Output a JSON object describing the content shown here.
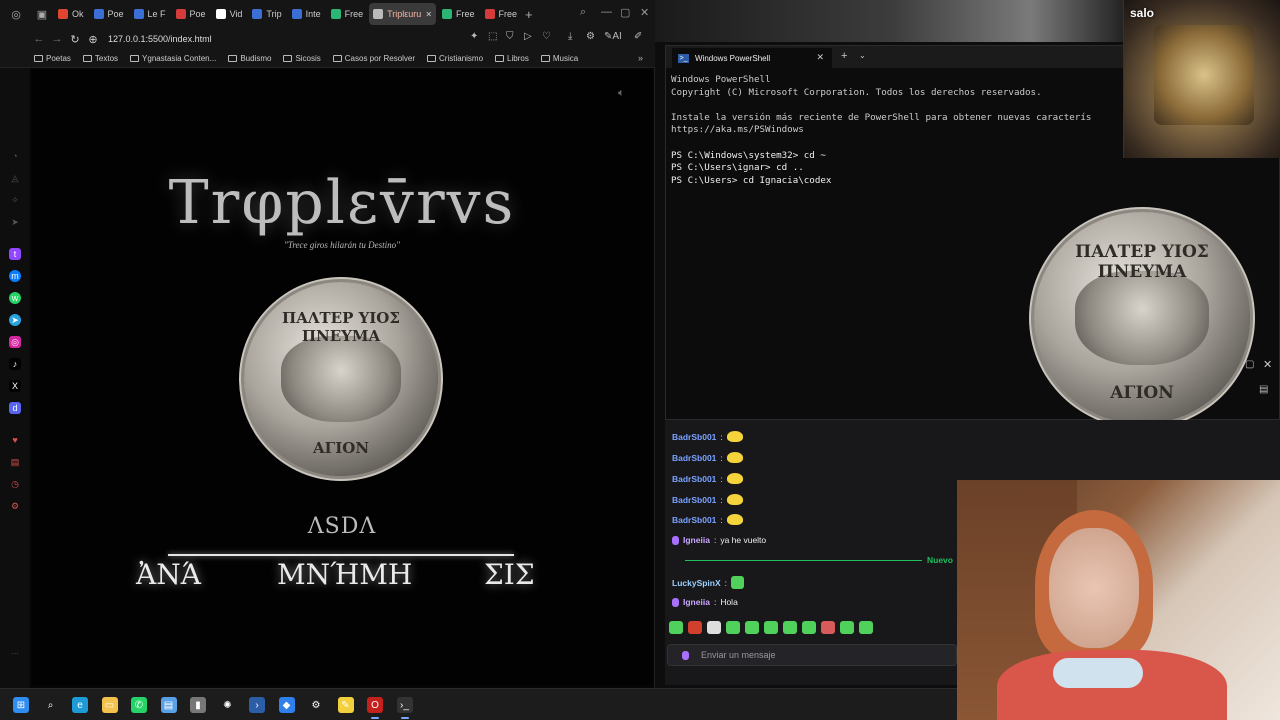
{
  "browser": {
    "tabs": [
      {
        "label": "Ok",
        "color": "#e0452f"
      },
      {
        "label": "Poe",
        "color": "#3b6fd6"
      },
      {
        "label": "Le F",
        "color": "#3b6fd6"
      },
      {
        "label": "Poe",
        "color": "#d63b3b"
      },
      {
        "label": "Vid",
        "color": "#ffffff"
      },
      {
        "label": "Trip",
        "color": "#3b6fd6"
      },
      {
        "label": "Inte",
        "color": "#3b6fd6"
      },
      {
        "label": "Free",
        "color": "#2bb673"
      },
      {
        "label": "Triplεuru",
        "color": "#bbbbbb",
        "active": true
      },
      {
        "label": "Free",
        "color": "#2bb673"
      },
      {
        "label": "Free",
        "color": "#d63b3b"
      }
    ],
    "url": "127.0.0.1:5500/index.html",
    "bookmarks": [
      "Poetas",
      "Textos",
      "Ygnastasia Conten...",
      "Budismo",
      "Sicosis",
      "Casos por Resolver",
      "Cristianismo",
      "Libros",
      "Musica"
    ],
    "toolbar_ai": "AI"
  },
  "page": {
    "title": "Trφplεv̄rvs",
    "subtitle": "\"Trece giros hilarán tu Destino\"",
    "coin_top_text": "ΠΑΛΤΕΡ ΥΙΟΣ ΠΝΕΥΜΑ",
    "coin_bottom_text": "ΑΓΙΟΝ",
    "asda": "ΛSDΛ",
    "word_left": "ἈΝΆ",
    "word_center": "ΜΝΉΜΗ",
    "word_right": "ΣΙΣ"
  },
  "powershell": {
    "tab_title": "Windows PowerShell",
    "lines": [
      {
        "text": "Windows PowerShell",
        "cmd": false
      },
      {
        "text": "Copyright (C) Microsoft Corporation. Todos los derechos reservados.",
        "cmd": false
      },
      {
        "text": "",
        "cmd": false
      },
      {
        "text": "Instale la versión más reciente de PowerShell para obtener nuevas caracterís",
        "cmd": false
      },
      {
        "text": "https://aka.ms/PSWindows",
        "cmd": false
      },
      {
        "text": "",
        "cmd": false
      },
      {
        "text": "PS C:\\Windows\\system32> cd ~",
        "cmd": true
      },
      {
        "text": "PS C:\\Users\\ignar> cd ..",
        "cmd": true
      },
      {
        "text": "PS C:\\Users> cd Ignacia\\codex",
        "cmd": true
      }
    ]
  },
  "overlay": {
    "label": "salo"
  },
  "chat": {
    "messages": [
      {
        "user": "BadrSb001",
        "text": "",
        "emote": "yellow"
      },
      {
        "user": "BadrSb001",
        "text": "",
        "emote": "yellow"
      },
      {
        "user": "BadrSb001",
        "text": "",
        "emote": "yellow"
      },
      {
        "user": "BadrSb001",
        "text": "",
        "emote": "yellow"
      },
      {
        "user": "BadrSb001",
        "text": "",
        "emote": "yellow"
      },
      {
        "user": "Igneiia",
        "text": "ya he vuelto",
        "emote": ""
      },
      {
        "user": "LuckySpinX",
        "text": "",
        "emote": "green"
      },
      {
        "user": "Igneiia",
        "text": "Hola",
        "emote": ""
      }
    ],
    "new_label": "Nuevo",
    "input_placeholder": "Enviar un mensaje",
    "emote_colors": [
      "#4fd15b",
      "#d0402c",
      "#dddddd",
      "#4fd15b",
      "#4fd15b",
      "#4fd15b",
      "#4fd15b",
      "#4fd15b",
      "#d85a5a",
      "#4fd15b",
      "#4fd15b"
    ]
  },
  "taskbar": {
    "apps": [
      "start",
      "search",
      "edge",
      "explorer",
      "whatsapp",
      "notepad",
      "usb",
      "chatgpt",
      "powershell",
      "vscode",
      "tool",
      "sticky",
      "opera",
      "terminal"
    ]
  }
}
